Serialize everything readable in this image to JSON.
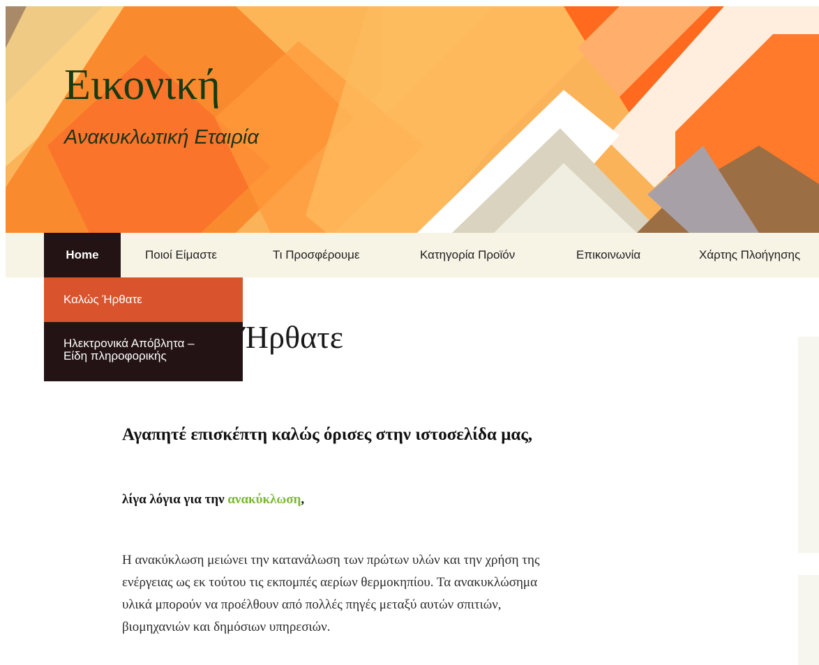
{
  "site": {
    "title": "Εικονική",
    "tagline": "Ανακυκλωτική Εταιρία"
  },
  "nav": {
    "items": [
      {
        "label": "Home"
      },
      {
        "label": "Ποιοί Είμαστε"
      },
      {
        "label": "Τι Προσφέρουμε"
      },
      {
        "label": "Κατηγορία Προϊόν"
      },
      {
        "label": "Επικοινωνία"
      },
      {
        "label": "Χάρτης Πλοήγησης"
      }
    ],
    "dropdown": [
      {
        "label": "Καλώς Ήρθατε"
      },
      {
        "label_line1": "Ηλεκτρονικά Απόβλητα –",
        "label_line2": "Είδη πληροφορικής"
      }
    ]
  },
  "page": {
    "title_visible": "Ήρθατε",
    "heading": "Αγαπητέ επισκέπτη καλώς όρισες στην ιστοσελίδα μας,",
    "intro_before": "λίγα λόγια για την",
    "intro_link": "ανακύκλωση",
    "intro_after": ",",
    "body_lines": [
      "Η ανακύκλωση μειώνει την κατανάλωση των πρώτων υλών και την χρήση της",
      "ενέργειας  ως εκ τούτου τις εκπομπές αερίων θερμοκηπίου. Τα ανακυκλώσημα",
      "υλικά μπορούν να προέλθουν από πολλές πηγές μεταξύ αυτών σπιτιών,",
      "βιομηχανιών και δημόσιων υπηρεσιών."
    ]
  },
  "colors": {
    "nav_active_bg": "#231314",
    "nav_bar_bg": "#f7f4e6",
    "dropdown_highlight": "#d9532c",
    "link_green": "#7ab831",
    "title_green": "#163a12"
  }
}
